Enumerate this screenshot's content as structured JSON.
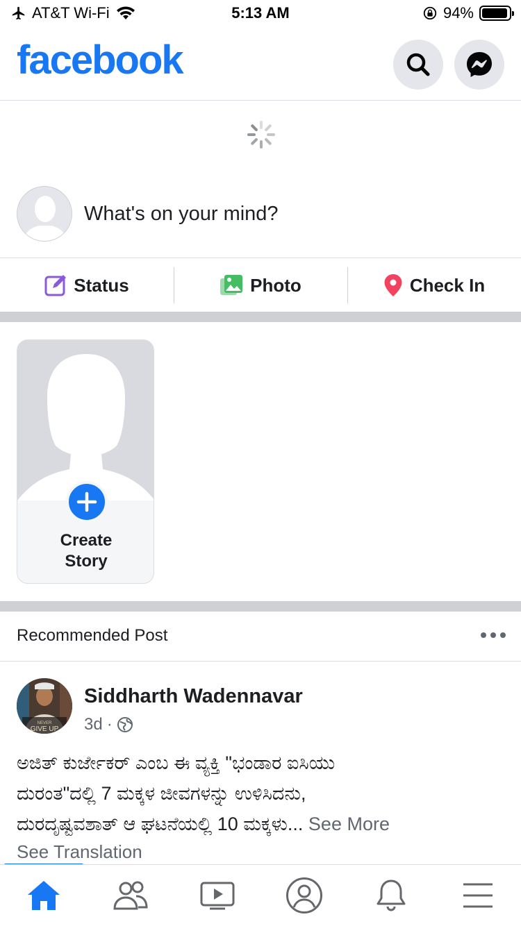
{
  "status_bar": {
    "carrier": "AT&T Wi-Fi",
    "time": "5:13 AM",
    "battery_percent": "94%",
    "battery_level": 0.94,
    "icons": [
      "airplane-icon",
      "wifi-icon",
      "orientation-lock-icon",
      "battery-icon"
    ]
  },
  "header": {
    "logo": "facebook",
    "buttons": [
      "search-icon",
      "messenger-icon"
    ]
  },
  "composer": {
    "prompt": "What's on your mind?",
    "actions": [
      {
        "label": "Status",
        "icon": "edit-icon",
        "color": "#8c5ad6"
      },
      {
        "label": "Photo",
        "icon": "photo-icon",
        "color": "#45bd62"
      },
      {
        "label": "Check In",
        "icon": "location-pin-icon",
        "color": "#f3425f"
      }
    ]
  },
  "story": {
    "label_line1": "Create",
    "label_line2": "Story"
  },
  "recommended": {
    "title": "Recommended Post",
    "post": {
      "author": "Siddharth Wadennavar",
      "time": "3d",
      "separator": "·",
      "privacy_icon": "globe-icon",
      "avatar_text": "NEVER GIVE UP",
      "text_line1": "ಅಜಿತ್ ಕುರ್ಜೇಕರ್ ಎಂಬ ಈ ವ್ಯಕ್ತಿ  \"ಭಂಡಾರ ಐಸಿಯು",
      "text_line2": "ದುರಂತ\"ದಲ್ಲಿ 7 ಮಕ್ಕಳ ಜೀವಗಳನ್ನು ಉಳಿಸಿದನು,",
      "text_line3": "ದುರದೃಷ್ಟವಶಾತ್ ಆ ಘಟನೆಯಲ್ಲಿ 10 ಮಕ್ಕಳು...",
      "see_more": "See More",
      "see_translation": "See Translation"
    }
  },
  "tabbar": {
    "tabs": [
      "home-icon",
      "friends-icon",
      "watch-icon",
      "profile-icon",
      "notifications-icon",
      "menu-icon"
    ],
    "active": "home-icon",
    "accent": "#1877f2"
  }
}
